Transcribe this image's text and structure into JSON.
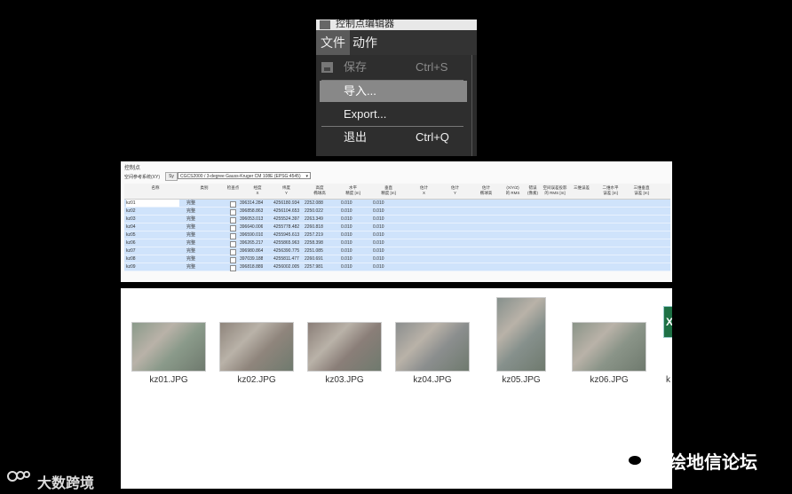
{
  "menu": {
    "title": "控制点编辑器",
    "menubar": {
      "file": "文件",
      "action": "动作"
    },
    "items": [
      {
        "label": "保存",
        "shortcut": "Ctrl+S",
        "enabled": false
      },
      {
        "label": "导入...",
        "shortcut": "",
        "highlighted": true
      },
      {
        "label": "Export...",
        "shortcut": ""
      },
      {
        "label": "退出",
        "shortcut": "Ctrl+Q"
      }
    ]
  },
  "table": {
    "title": "控制点",
    "crs_label": "空间参考系统(XY)",
    "crs_button": "Sy",
    "crs_value": "CGCS2000 / 3-degree Gauss-Kruger CM 108E (EPSG:4545)",
    "headers": [
      "名称",
      "类别",
      "检查点",
      "经度\nX",
      "纬度\nY",
      "高度\n椭球高",
      "水平\n精度 [m]",
      "垂直\n精度 [m]",
      "估计\nX",
      "估计\nY",
      "估计\n椭球高",
      "(X/Y/Z)\n的 RMS",
      "错误\n(像素)",
      "空间误差投影\n的 RMS [m]",
      "三维误差",
      "二维水平\n误差 [m]",
      "三维垂直\n误差 [m]"
    ],
    "rows": [
      {
        "name": "kz01",
        "type": "完整",
        "x": "396314.284",
        "y": "4256180.934",
        "z": "2252.088",
        "h": "0.010",
        "v": "0.010"
      },
      {
        "name": "kz02",
        "type": "完整",
        "x": "396858.863",
        "y": "4256104.653",
        "z": "2250.022",
        "h": "0.010",
        "v": "0.010"
      },
      {
        "name": "kz03",
        "type": "完整",
        "x": "396053.013",
        "y": "4255524.397",
        "z": "2263.349",
        "h": "0.010",
        "v": "0.010"
      },
      {
        "name": "kz04",
        "type": "完整",
        "x": "396640.006",
        "y": "4255778.482",
        "z": "2260.818",
        "h": "0.010",
        "v": "0.010"
      },
      {
        "name": "kz05",
        "type": "完整",
        "x": "396590.010",
        "y": "4255945.613",
        "z": "2257.219",
        "h": "0.010",
        "v": "0.010"
      },
      {
        "name": "kz06",
        "type": "完整",
        "x": "396265.217",
        "y": "4255865.963",
        "z": "2258.398",
        "h": "0.010",
        "v": "0.010"
      },
      {
        "name": "kz07",
        "type": "完整",
        "x": "396980.864",
        "y": "4256390.775",
        "z": "2251.085",
        "h": "0.010",
        "v": "0.010"
      },
      {
        "name": "kz08",
        "type": "完整",
        "x": "397039.188",
        "y": "4255811.477",
        "z": "2260.691",
        "h": "0.010",
        "v": "0.010"
      },
      {
        "name": "kz09",
        "type": "完整",
        "x": "396818.889",
        "y": "4256002.005",
        "z": "2257.981",
        "h": "0.010",
        "v": "0.010"
      }
    ]
  },
  "files": [
    {
      "name": "kz01.JPG",
      "tone": "#8a9a8a"
    },
    {
      "name": "kz02.JPG",
      "tone": "#8f857c"
    },
    {
      "name": "kz03.JPG",
      "tone": "#8a7e78"
    },
    {
      "name": "kz04.JPG",
      "tone": "#8b8e8e"
    },
    {
      "name": "kz05.JPG",
      "tone": "#86908c"
    },
    {
      "name": "kz06.JPG",
      "tone": "#8a9488"
    }
  ],
  "files_cut_label": "k",
  "watermarks": {
    "left": "大数跨境",
    "right": "测绘地信论坛"
  }
}
